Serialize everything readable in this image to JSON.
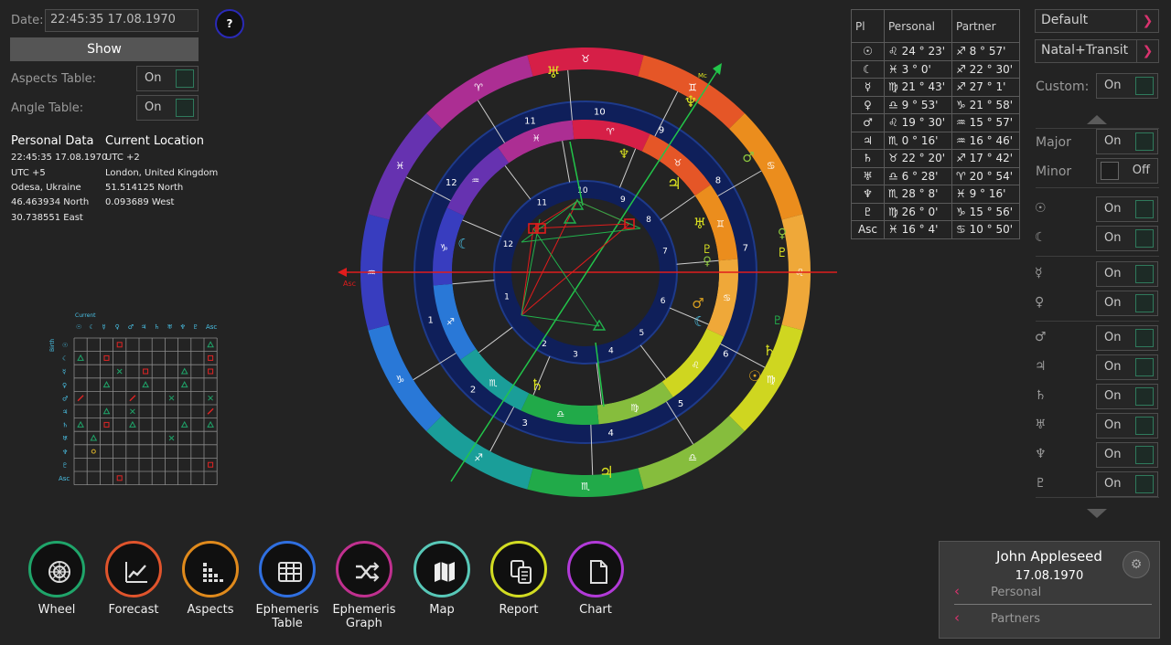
{
  "controls": {
    "date_label": "Date:",
    "date_value": "22:45:35 17.08.1970",
    "show_label": "Show",
    "help_label": "?",
    "aspects_table_label": "Aspects Table:",
    "aspects_table_state": "On",
    "angle_table_label": "Angle Table:",
    "angle_table_state": "On"
  },
  "personal": {
    "title": "Personal Data",
    "lines": [
      "22:45:35 17.08.1970",
      "UTC +5",
      "Odesa, Ukraine",
      "46.463934 North",
      "30.738551 East"
    ]
  },
  "location": {
    "title": "Current Location",
    "lines": [
      "UTC +2",
      "London, United Kingdom",
      "51.514125 North",
      "0.093689 West"
    ]
  },
  "aspect_grid": {
    "header": "Current",
    "symbols": [
      "☉",
      "☾",
      "☿",
      "♀",
      "♂",
      "♃",
      "♄",
      "♅",
      "♆",
      "♇",
      "Asc"
    ],
    "row_header": "Birth"
  },
  "wheel": {
    "asc_label": "Asc",
    "mc_label": "Mc",
    "outer_houses": [
      "1",
      "2",
      "3",
      "4",
      "5",
      "6",
      "7",
      "8",
      "9",
      "10",
      "11",
      "12"
    ],
    "inner_houses": [
      "1",
      "2",
      "3",
      "4",
      "5",
      "6",
      "7",
      "8",
      "9",
      "10",
      "11",
      "12"
    ]
  },
  "ephemeris": {
    "headers": [
      "Pl",
      "Personal",
      "Partner"
    ],
    "rows": [
      {
        "pl": "☉",
        "personal": "♌ 24 ° 23'",
        "partner": "♐ 8 ° 57'"
      },
      {
        "pl": "☾",
        "personal": "♓ 3 ° 0'",
        "partner": "♐ 22 ° 30'"
      },
      {
        "pl": "☿",
        "personal": "♍ 21 ° 43'",
        "partner": "♐ 27 ° 1'"
      },
      {
        "pl": "♀",
        "personal": "♎ 9 ° 53'",
        "partner": "♑ 21 ° 58'"
      },
      {
        "pl": "♂",
        "personal": "♌ 19 ° 30'",
        "partner": "♒ 15 ° 57'"
      },
      {
        "pl": "♃",
        "personal": "♏ 0 ° 16'",
        "partner": "♒ 16 ° 46'"
      },
      {
        "pl": "♄",
        "personal": "♉ 22 ° 20'",
        "partner": "♐ 17 ° 42'"
      },
      {
        "pl": "♅",
        "personal": "♎ 6 ° 28'",
        "partner": "♈ 20 ° 54'"
      },
      {
        "pl": "♆",
        "personal": "♏ 28 ° 8'",
        "partner": "♓ 9 ° 16'"
      },
      {
        "pl": "♇",
        "personal": "♍ 26 ° 0'",
        "partner": "♑ 15 ° 56'"
      },
      {
        "pl": "Asc",
        "personal": "♓ 16 ° 4'",
        "partner": "♋ 10 ° 50'"
      }
    ]
  },
  "right_panel": {
    "preset": "Default",
    "mode": "Natal+Transit",
    "custom_label": "Custom:",
    "custom_state": "On",
    "major_label": "Major",
    "major_state": "On",
    "minor_label": "Minor",
    "minor_state": "Off",
    "planets": [
      {
        "sym": "☉",
        "state": "On"
      },
      {
        "sym": "☾",
        "state": "On"
      },
      {
        "sym": "☿",
        "state": "On"
      },
      {
        "sym": "♀",
        "state": "On"
      },
      {
        "sym": "♂",
        "state": "On"
      },
      {
        "sym": "♃",
        "state": "On"
      },
      {
        "sym": "♄",
        "state": "On"
      },
      {
        "sym": "♅",
        "state": "On"
      },
      {
        "sym": "♆",
        "state": "On"
      },
      {
        "sym": "♇",
        "state": "On"
      }
    ]
  },
  "profile": {
    "name": "John Appleseed",
    "date": "17.08.1970",
    "personal_label": "Personal",
    "partners_label": "Partners"
  },
  "nav": [
    {
      "label": "Wheel",
      "icon": "wheel-icon",
      "color": "#1fa56a"
    },
    {
      "label": "Forecast",
      "icon": "forecast-icon",
      "color": "#e0542c"
    },
    {
      "label": "Aspects",
      "icon": "aspects-icon",
      "color": "#e08a1c"
    },
    {
      "label": "Ephemeris Table",
      "icon": "ephemeris-table-icon",
      "color": "#2f6fe0"
    },
    {
      "label": "Ephemeris Graph",
      "icon": "ephemeris-graph-icon",
      "color": "#c0308f"
    },
    {
      "label": "Map",
      "icon": "map-icon",
      "color": "#58c8b8"
    },
    {
      "label": "Report",
      "icon": "report-icon",
      "color": "#d2dc22"
    },
    {
      "label": "Chart",
      "icon": "chart-icon",
      "color": "#b23ad8"
    }
  ]
}
